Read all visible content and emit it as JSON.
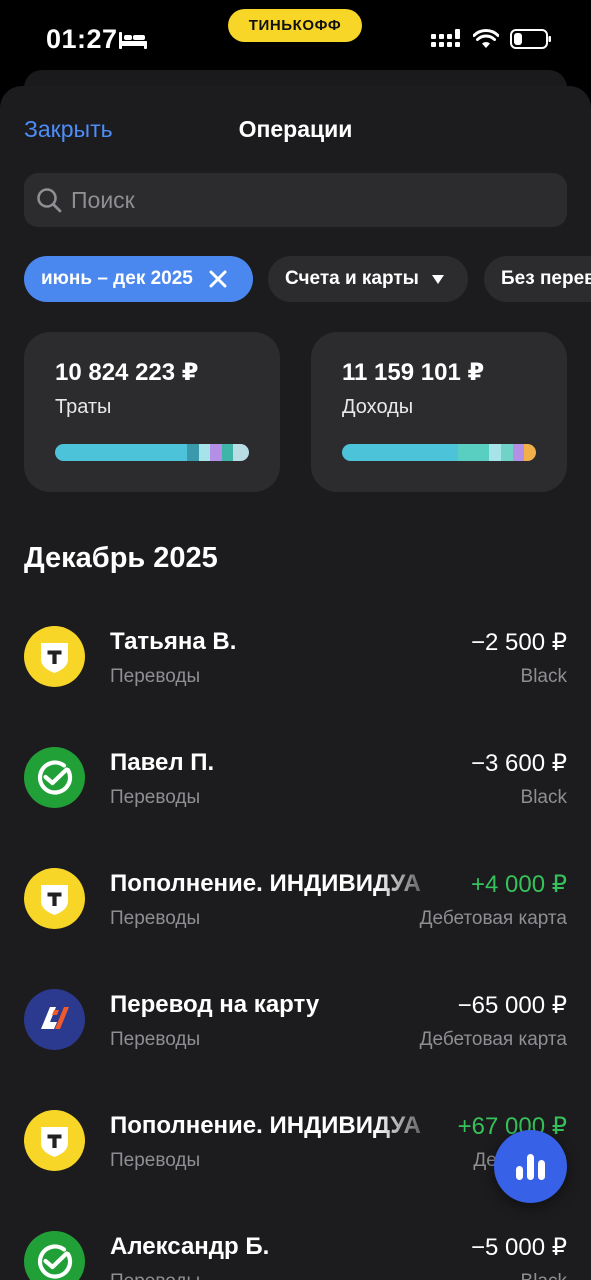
{
  "status_bar": {
    "time": "01:27",
    "carrier_pill": "ТИНЬКОФФ",
    "icons": [
      "bed-icon",
      "signal-icon",
      "wifi-icon",
      "battery-icon"
    ]
  },
  "header": {
    "close_label": "Закрыть",
    "title": "Операции"
  },
  "search": {
    "placeholder": "Поиск",
    "value": ""
  },
  "filters": {
    "date_range": "июнь – дек 2025",
    "accounts": "Счета и карты",
    "third": "Без перев"
  },
  "summary": {
    "spend": {
      "amount": "10 824 223 ₽",
      "label": "Траты",
      "segments": [
        {
          "share": 0.68,
          "color": "#4cc3d8"
        },
        {
          "share": 0.06,
          "color": "#3a9aab"
        },
        {
          "share": 0.06,
          "color": "#a6e4ea"
        },
        {
          "share": 0.06,
          "color": "#b48fe6"
        },
        {
          "share": 0.06,
          "color": "#3fb4a8"
        },
        {
          "share": 0.08,
          "color": "#b9dde4"
        }
      ]
    },
    "income": {
      "amount": "11 159 101 ₽",
      "label": "Доходы",
      "segments": [
        {
          "share": 0.6,
          "color": "#4cc3d8"
        },
        {
          "share": 0.16,
          "color": "#58cfc0"
        },
        {
          "share": 0.06,
          "color": "#a6e4ea"
        },
        {
          "share": 0.06,
          "color": "#6fd3c8"
        },
        {
          "share": 0.06,
          "color": "#b48fe6"
        },
        {
          "share": 0.06,
          "color": "#f2b04a"
        }
      ]
    }
  },
  "section": {
    "title": "Декабрь 2025"
  },
  "transactions": [
    {
      "name": "Татьяна В.",
      "category": "Переводы",
      "amount": "−2 500 ₽",
      "account": "Black",
      "positive": false,
      "logo": "tinkoff"
    },
    {
      "name": "Павел П.",
      "category": "Переводы",
      "amount": "−3 600 ₽",
      "account": "Black",
      "positive": false,
      "logo": "sber"
    },
    {
      "name": "Пополнение. ИНДИВИДУА",
      "category": "Переводы",
      "amount": "+4 000 ₽",
      "account": "Дебетовая карта",
      "positive": true,
      "logo": "tinkoff"
    },
    {
      "name": "Перевод на карту",
      "category": "Переводы",
      "amount": "−65 000 ₽",
      "account": "Дебетовая карта",
      "positive": false,
      "logo": "bank-blue"
    },
    {
      "name": "Пополнение. ИНДИВИДУА",
      "category": "Переводы",
      "amount": "+67 000 ₽",
      "account": "Дебетовая",
      "positive": true,
      "logo": "tinkoff"
    },
    {
      "name": "Александр Б.",
      "category": "Переводы",
      "amount": "−5 000 ₽",
      "account": "Black",
      "positive": false,
      "logo": "sber"
    }
  ],
  "colors": {
    "accent": "#4a88f0",
    "positive": "#36c25a",
    "tinkoff_yellow": "#f7d628",
    "sber_green": "#21a038",
    "bank_blue": "#2b3a8e",
    "fab": "#3762e8"
  },
  "fab": {
    "icon": "analytics-bars-icon"
  }
}
